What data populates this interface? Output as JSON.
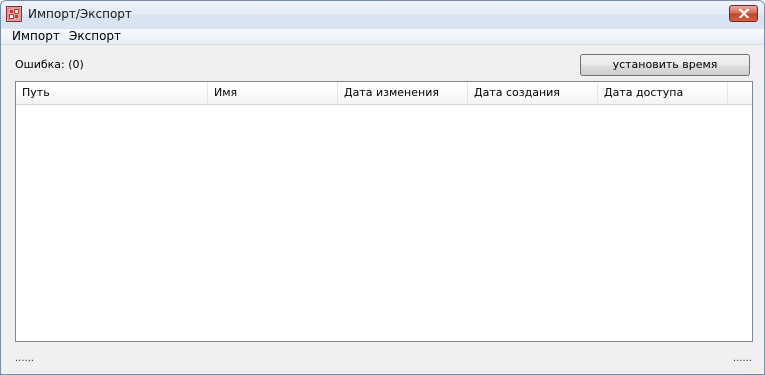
{
  "window": {
    "title": "Импорт/Экспорт"
  },
  "menu": {
    "items": [
      {
        "label": "Импорт"
      },
      {
        "label": "Экспорт"
      }
    ]
  },
  "toolbar": {
    "error_label": "Ошибка: (0)",
    "set_time_label": "установить время"
  },
  "list": {
    "columns": [
      {
        "label": "Путь"
      },
      {
        "label": "Имя"
      },
      {
        "label": "Дата изменения"
      },
      {
        "label": "Дата создания"
      },
      {
        "label": "Дата доступа"
      }
    ],
    "rows": []
  },
  "status": {
    "left": "......",
    "right": "......"
  },
  "icons": {
    "app": "app-icon",
    "close": "close-icon"
  },
  "colors": {
    "close_button": "#c4442c",
    "title_bar": "#dce6f2",
    "window_bg": "#f0f0f0"
  }
}
